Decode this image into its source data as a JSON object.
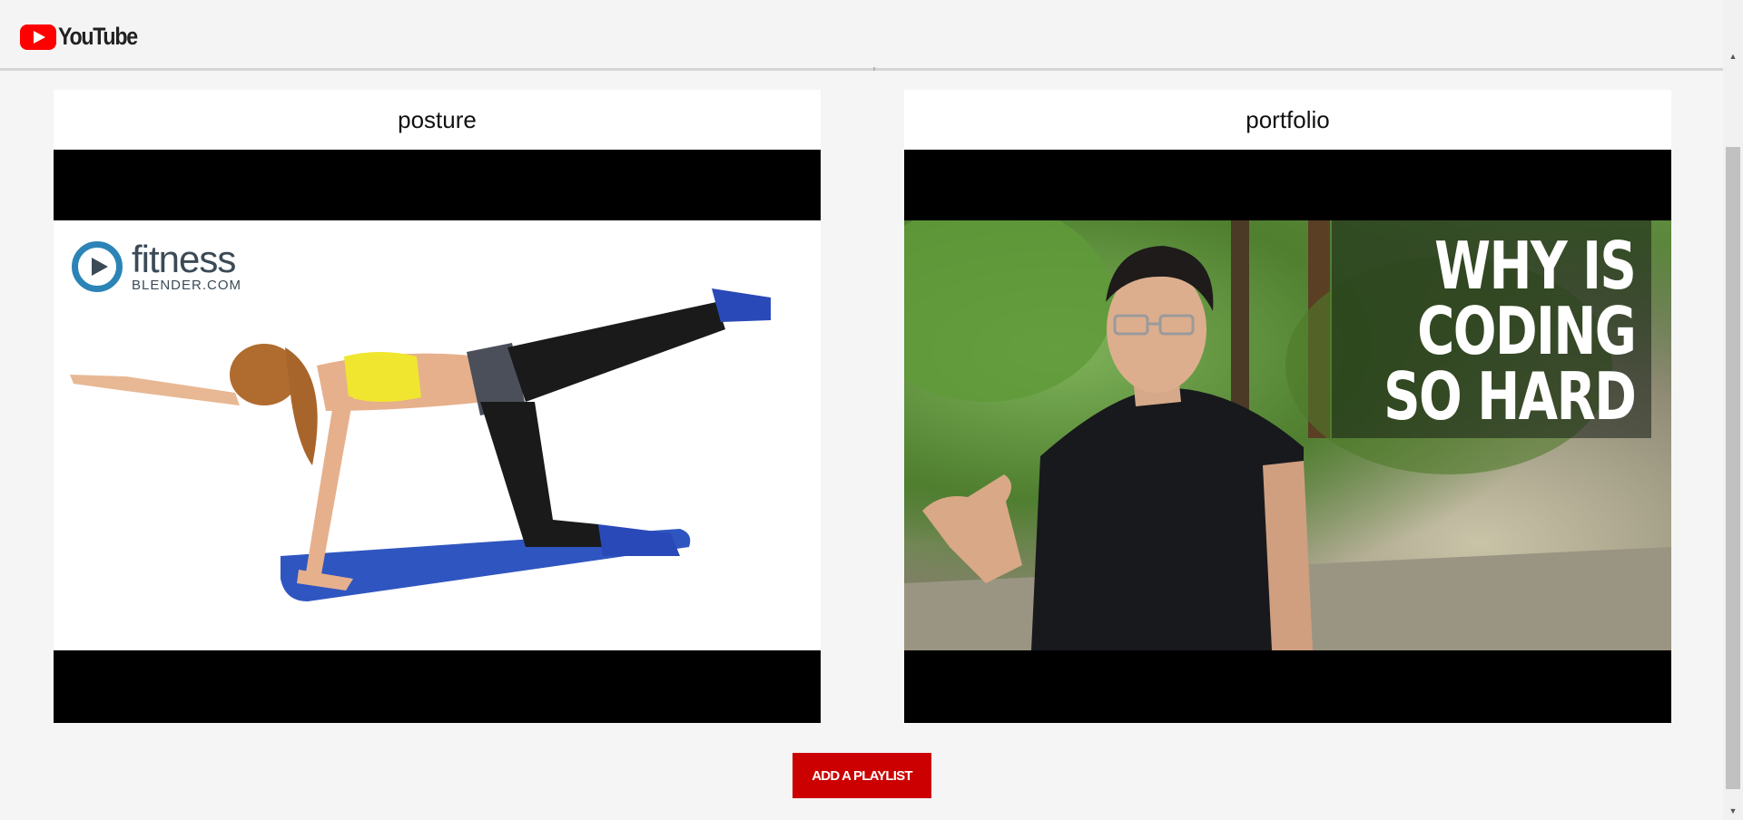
{
  "header": {
    "logo_text": "YouTube"
  },
  "playlists": [
    {
      "title": "posture",
      "thumbnail": {
        "channel_logo_name": "fitness",
        "channel_logo_site": "BLENDER.COM"
      }
    },
    {
      "title": "portfolio",
      "thumbnail": {
        "overlay_lines": [
          "WHY IS",
          "CODING",
          "SO HARD"
        ]
      }
    }
  ],
  "actions": {
    "add_playlist_label": "ADD A PLAYLIST"
  },
  "colors": {
    "brand_red": "#ff0000",
    "button_red": "#cc0000",
    "background": "#f5f5f5"
  }
}
